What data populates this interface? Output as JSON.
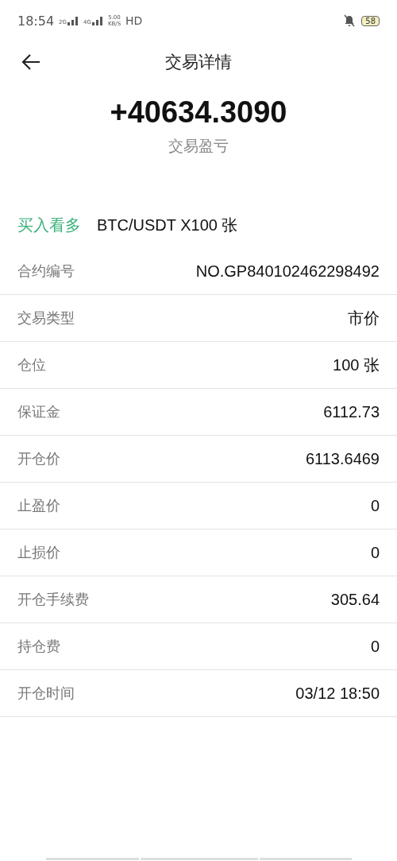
{
  "status_bar": {
    "time": "18:54",
    "network_1": "2G",
    "network_2": "4G",
    "speed_value": "5.00",
    "speed_unit": "KB/S",
    "hd": "HD",
    "battery": "58"
  },
  "header": {
    "title": "交易详情"
  },
  "summary": {
    "amount": "+40634.3090",
    "label": "交易盈亏"
  },
  "position": {
    "direction": "买入看多",
    "instrument": "BTC/USDT X100 张"
  },
  "details": [
    {
      "label": "合约编号",
      "value": "NO.GP840102462298492"
    },
    {
      "label": "交易类型",
      "value": "市价"
    },
    {
      "label": "仓位",
      "value": "100 张"
    },
    {
      "label": "保证金",
      "value": "6112.73"
    },
    {
      "label": "开仓价",
      "value": "6113.6469"
    },
    {
      "label": "止盈价",
      "value": "0"
    },
    {
      "label": "止损价",
      "value": "0"
    },
    {
      "label": "开仓手续费",
      "value": "305.64"
    },
    {
      "label": "持仓费",
      "value": "0"
    },
    {
      "label": "开仓时间",
      "value": "03/12 18:50"
    }
  ]
}
